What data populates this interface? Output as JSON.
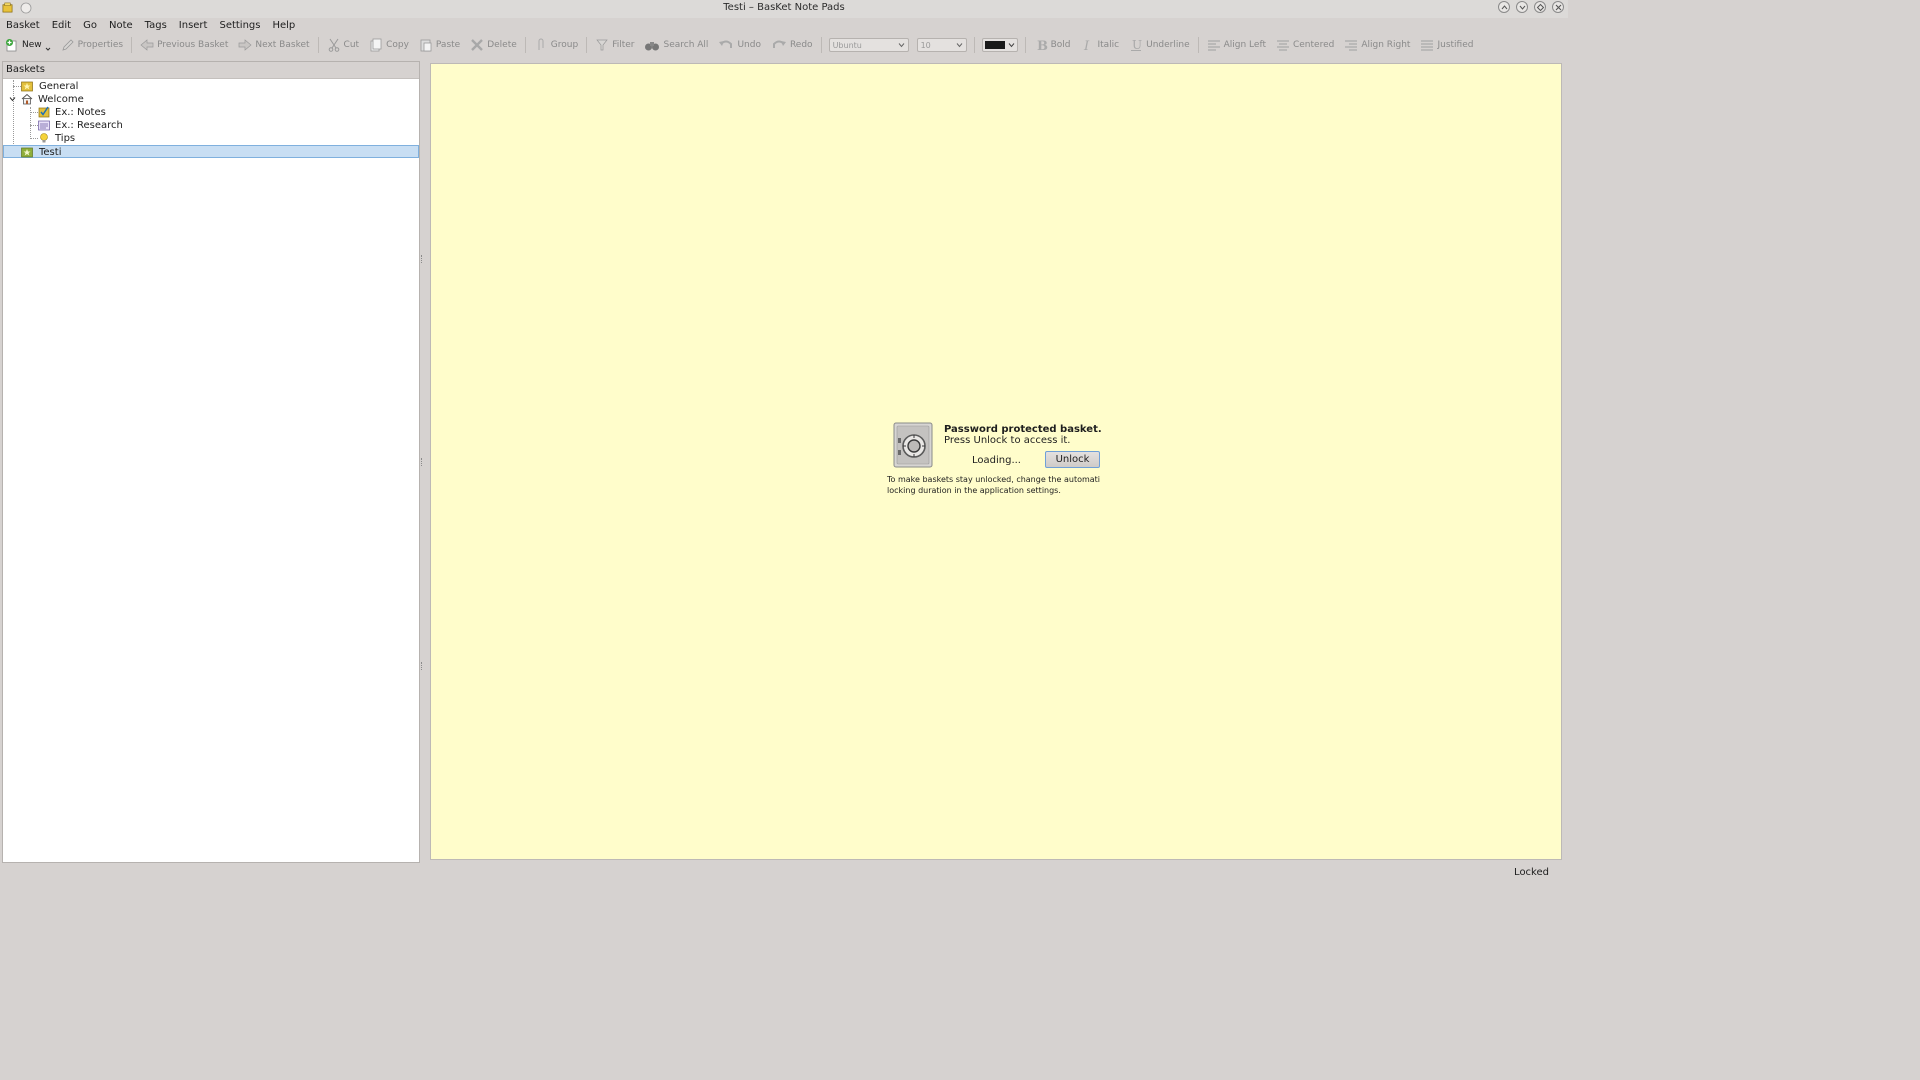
{
  "window": {
    "title": "Testi – BasKet Note Pads"
  },
  "menubar": [
    "Basket",
    "Edit",
    "Go",
    "Note",
    "Tags",
    "Insert",
    "Settings",
    "Help"
  ],
  "toolbar": {
    "new": "New",
    "properties": "Properties",
    "previous_basket": "Previous Basket",
    "next_basket": "Next Basket",
    "cut": "Cut",
    "copy": "Copy",
    "paste": "Paste",
    "delete": "Delete",
    "group": "Group",
    "filter": "Filter",
    "search_all": "Search All",
    "undo": "Undo",
    "redo": "Redo",
    "font": "Ubuntu",
    "font_size": "10",
    "text_color": "#1a1a1a",
    "bold": "Bold",
    "italic": "Italic",
    "underline": "Underline",
    "align_left": "Align Left",
    "centered": "Centered",
    "align_right": "Align Right",
    "justified": "Justified"
  },
  "sidebar": {
    "header": "Baskets",
    "items": [
      {
        "label": "General",
        "icon": "folder-star-icon"
      },
      {
        "label": "Welcome",
        "icon": "home-icon",
        "expanded": true
      },
      {
        "label": "Ex.: Notes",
        "icon": "checklist-icon"
      },
      {
        "label": "Ex.: Research",
        "icon": "research-icon"
      },
      {
        "label": "Tips",
        "icon": "lightbulb-icon"
      },
      {
        "label": "Testi",
        "icon": "folder-star-icon",
        "selected": true
      }
    ]
  },
  "basket": {
    "background": "#fffdcb",
    "lock_title": "Password protected basket.",
    "lock_subtitle": "Press Unlock to access it.",
    "loading": "Loading...",
    "unlock_button": "Unlock",
    "note": "To make baskets stay unlocked, change the automati locking duration in the application settings."
  },
  "status": {
    "text": "Locked"
  }
}
